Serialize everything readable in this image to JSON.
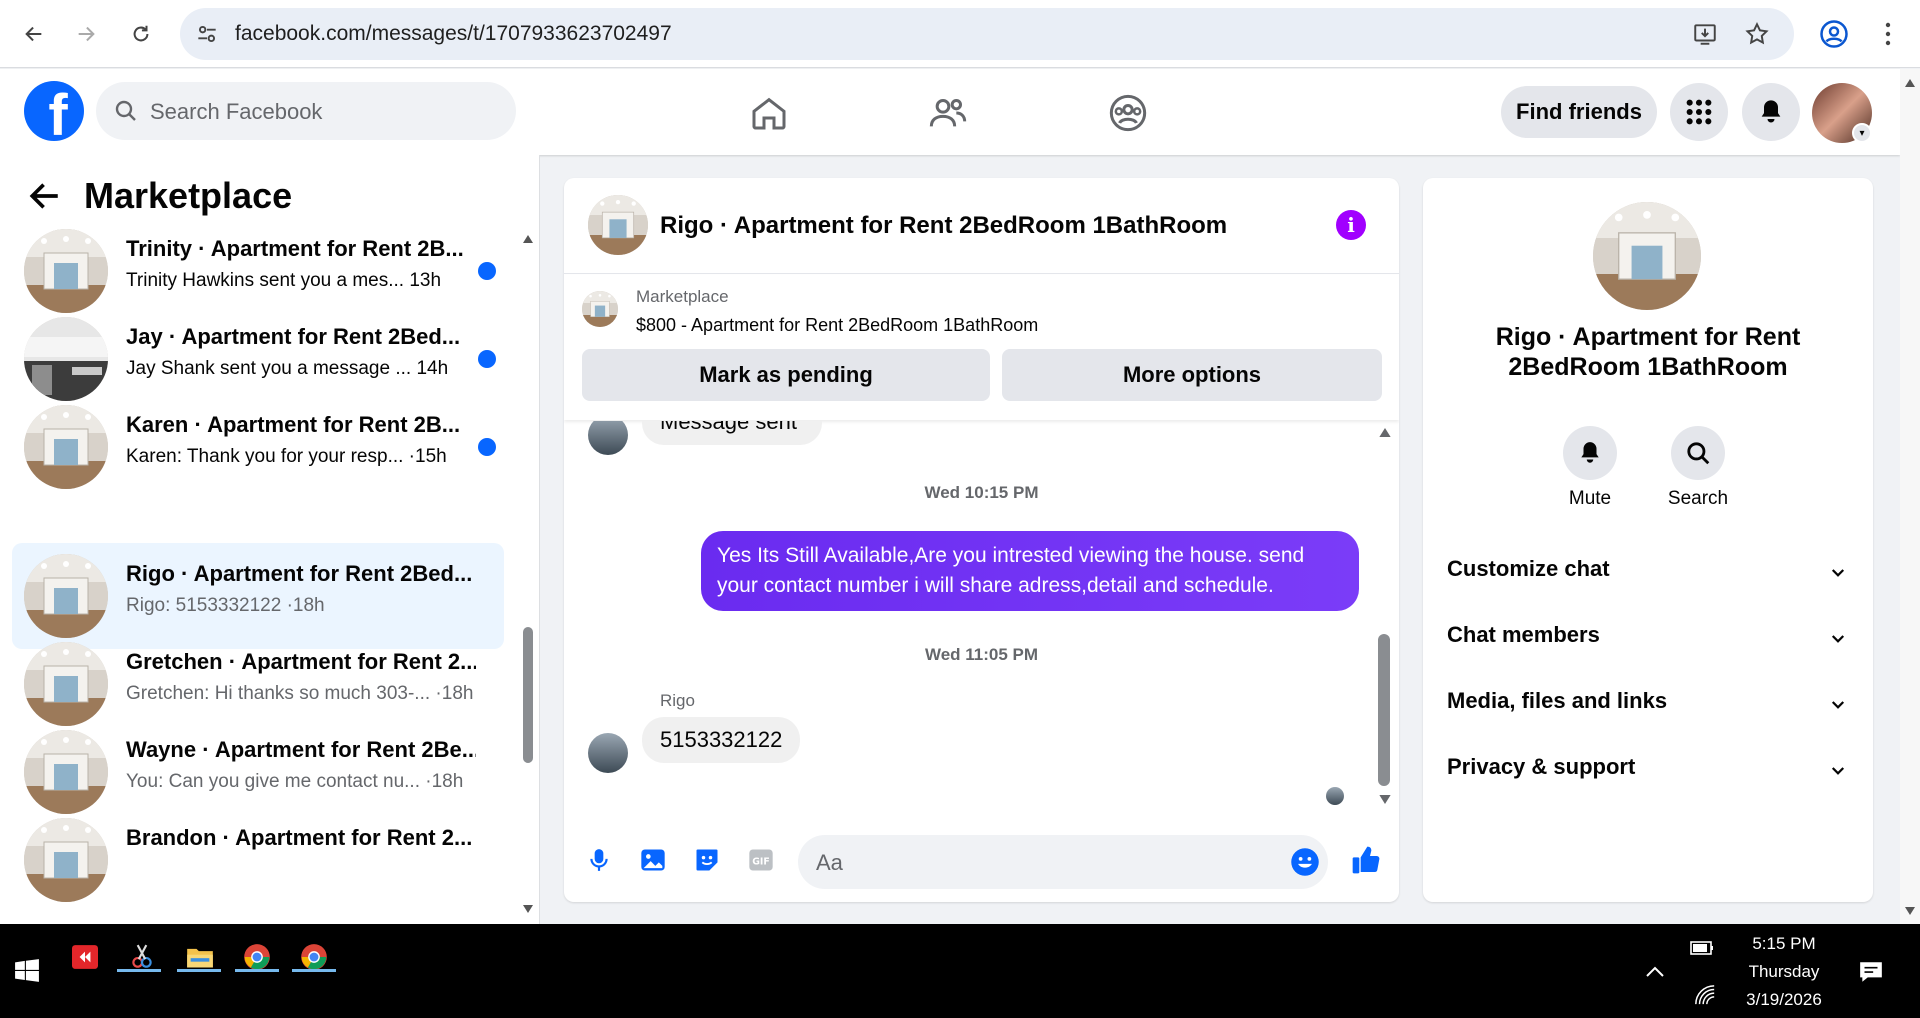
{
  "browser": {
    "url": "facebook.com/messages/t/1707933623702497"
  },
  "header": {
    "search_placeholder": "Search Facebook",
    "find_friends": "Find friends"
  },
  "sidebar": {
    "title": "Marketplace",
    "conversations": [
      {
        "name": "Trinity · Apartment for Rent 2B...",
        "preview": "Trinity Hawkins sent you a mes...",
        "time": "13h",
        "unread": true
      },
      {
        "name": "Jay · Apartment for Rent 2Bed...",
        "preview": "Jay Shank sent you a message ...",
        "time": "14h",
        "unread": true
      },
      {
        "name": "Karen · Apartment for Rent 2B...",
        "preview": "Karen: Thank you for your resp... ·",
        "time": "15h",
        "unread": true
      },
      {
        "name": "Rigo · Apartment for Rent 2Bed...",
        "preview": "Rigo: 5153332122 ·",
        "time": "18h",
        "unread": false
      },
      {
        "name": "Gretchen · Apartment for Rent 2...",
        "preview": "Gretchen: Hi thanks so much 303-... ·",
        "time": "18h",
        "unread": false
      },
      {
        "name": "Wayne · Apartment for Rent 2Be...",
        "preview": "You: Can you give me contact nu...  ·",
        "time": "18h",
        "unread": false
      },
      {
        "name": "Brandon · Apartment for Rent 2...",
        "preview": "",
        "time": "",
        "unread": false
      }
    ]
  },
  "chat": {
    "title": "Rigo · Apartment for Rent 2BedRoom 1BathRoom",
    "marketplace_label": "Marketplace",
    "listing": "$800 - Apartment for Rent 2BedRoom 1BathRoom",
    "mark_pending": "Mark as pending",
    "more_options": "More options",
    "partial_message": "Message sent",
    "timestamp1": "Wed 10:15 PM",
    "outgoing_message": "Yes Its Still Available,Are you intrested viewing the house. send your contact number i will share adress,detail and schedule.",
    "timestamp2": "Wed 11:05 PM",
    "sender": "Rigo",
    "incoming_message": "5153332122",
    "composer_placeholder": "Aa"
  },
  "details": {
    "title": "Rigo · Apartment for Rent 2BedRoom 1BathRoom",
    "mute": "Mute",
    "search": "Search",
    "sections": [
      "Customize chat",
      "Chat members",
      "Media, files and links",
      "Privacy & support"
    ]
  },
  "taskbar": {
    "time": "5:15 PM",
    "day": "Thursday",
    "date": "3/19/2026"
  },
  "colors": {
    "fb_blue": "#0866ff",
    "outgoing_bubble": "#7b3cf8",
    "unread_dot": "#0866ff",
    "info_icon": "#a100ff"
  }
}
